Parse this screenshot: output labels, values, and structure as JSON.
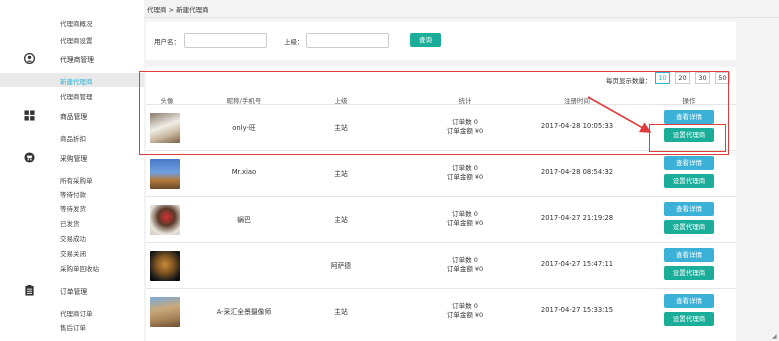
{
  "breadcrumb": "代理商 > 新建代理商",
  "sidebar": {
    "top_items": [
      "代理商概况",
      "代理商设置"
    ],
    "sections": [
      {
        "icon": "user-circle-icon",
        "label": "代理商管理",
        "items": [
          "新建代理商",
          "代理商管理"
        ],
        "active_index": 0
      },
      {
        "icon": "grid-icon",
        "label": "商品管理",
        "items": [
          "商品折扣"
        ]
      },
      {
        "icon": "cart-icon",
        "label": "采购管理",
        "items": [
          "所有采购单",
          "等待付款",
          "等待发货",
          "已发货",
          "交易成功",
          "交易关闭",
          "采购单回收站"
        ]
      },
      {
        "icon": "clipboard-icon",
        "label": "订单管理",
        "items": [
          "代理商订单",
          "售后订单"
        ]
      }
    ]
  },
  "filter": {
    "username_label": "用户名：",
    "superior_label": "上级：",
    "search_button": "查询"
  },
  "pager": {
    "label": "每页显示数量：",
    "options": [
      "10",
      "20",
      "30",
      "50"
    ],
    "selected": "10"
  },
  "table": {
    "headers": [
      "头像",
      "昵称/手机号",
      "上级",
      "统计",
      "注册时间",
      "操作"
    ],
    "rows": [
      {
        "nickname": "only-旺",
        "superior": "主站",
        "orders": "订单数 0",
        "amount": "订单金额 ¥0",
        "reg_time": "2017-04-28 10:05:33",
        "detail": "查看详情",
        "set_agent": "设置代理商"
      },
      {
        "nickname": "Mr.xiao",
        "superior": "主站",
        "orders": "订单数 0",
        "amount": "订单金额 ¥0",
        "reg_time": "2017-04-28 08:54:32",
        "detail": "查看详情",
        "set_agent": "设置代理商"
      },
      {
        "nickname": "蜗巴",
        "superior": "主站",
        "orders": "订单数 0",
        "amount": "订单金额 ¥0",
        "reg_time": "2017-04-27 21:19:28",
        "detail": "查看详情",
        "set_agent": "设置代理商"
      },
      {
        "nickname": "",
        "superior": "阿萨德",
        "orders": "订单数 0",
        "amount": "订单金额 ¥0",
        "reg_time": "2017-04-27 15:47:11",
        "detail": "查看详情",
        "set_agent": "设置代理商"
      },
      {
        "nickname": "A-采汇全景摄像师",
        "superior": "主站",
        "orders": "订单数 0",
        "amount": "订单金额 ¥0",
        "reg_time": "2017-04-27 15:33:15",
        "detail": "查看详情",
        "set_agent": "设置代理商"
      }
    ]
  },
  "colors": {
    "accent_teal": "#1aae9a",
    "accent_blue": "#3cb1d8",
    "active_menu": "#27b3d6",
    "annotation_red": "#e23b3b"
  }
}
